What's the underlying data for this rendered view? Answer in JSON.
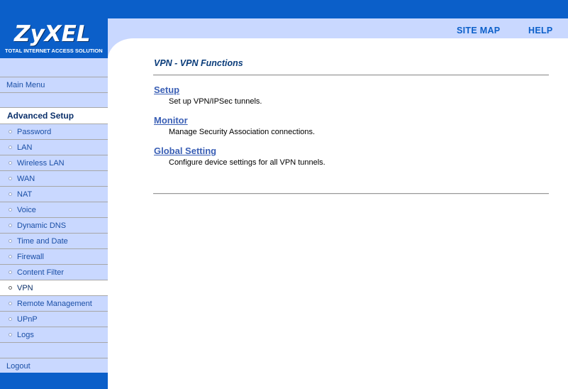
{
  "header": {
    "logo_text": "ZyXEL",
    "logo_tagline": "TOTAL INTERNET ACCESS SOLUTION",
    "site_map": "SITE MAP",
    "help": "HELP"
  },
  "sidebar": {
    "main_menu": "Main Menu",
    "advanced_setup": "Advanced Setup",
    "items": [
      {
        "label": "Password"
      },
      {
        "label": "LAN"
      },
      {
        "label": "Wireless LAN"
      },
      {
        "label": "WAN"
      },
      {
        "label": "NAT"
      },
      {
        "label": "Voice"
      },
      {
        "label": "Dynamic DNS"
      },
      {
        "label": "Time and Date"
      },
      {
        "label": "Firewall"
      },
      {
        "label": "Content Filter"
      },
      {
        "label": "VPN"
      },
      {
        "label": "Remote Management"
      },
      {
        "label": "UPnP"
      },
      {
        "label": "Logs"
      }
    ],
    "active_item": "VPN",
    "logout": "Logout"
  },
  "main": {
    "title": "VPN - VPN Functions",
    "functions": [
      {
        "link": "Setup",
        "description": "Set up VPN/IPSec tunnels."
      },
      {
        "link": "Monitor",
        "description": "Manage Security Association connections."
      },
      {
        "link": "Global Setting",
        "description": "Configure device settings for all VPN tunnels."
      }
    ]
  },
  "colors": {
    "brand_blue": "#0b5fc9",
    "nav_background": "#c9d8ff",
    "link_blue": "#3a5fb5"
  }
}
